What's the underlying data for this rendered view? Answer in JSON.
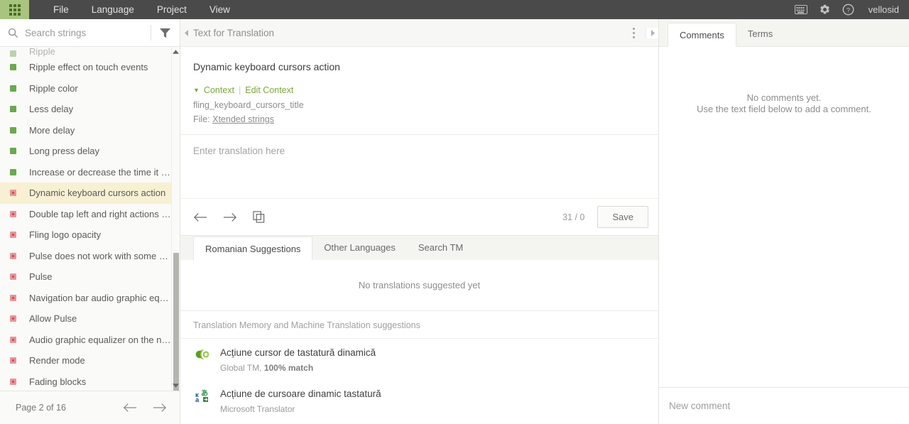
{
  "topbar": {
    "launcher_icon": "app-grid-icon",
    "menu": [
      {
        "label": "File"
      },
      {
        "label": "Language"
      },
      {
        "label": "Project"
      },
      {
        "label": "View"
      }
    ],
    "icons": [
      {
        "name": "keyboard-icon"
      },
      {
        "name": "gear-icon"
      },
      {
        "name": "help-icon"
      }
    ],
    "username": "vellosid"
  },
  "sidebar": {
    "search": {
      "value": "",
      "placeholder": "Search strings",
      "icon": "search-icon"
    },
    "filter_icon": "filter-icon",
    "items": [
      {
        "label": "Ripple effect on touch events",
        "status": "translated"
      },
      {
        "label": "Ripple color",
        "status": "translated"
      },
      {
        "label": "Less delay",
        "status": "translated"
      },
      {
        "label": "More delay",
        "status": "translated"
      },
      {
        "label": "Long press delay",
        "status": "translated"
      },
      {
        "label": "Increase or decrease the time it take...",
        "status": "translated"
      },
      {
        "label": "Dynamic keyboard cursors action",
        "status": "untranslated",
        "selected": true
      },
      {
        "label": "Double tap left and right actions bec...",
        "status": "untranslated"
      },
      {
        "label": "Fling logo opacity",
        "status": "untranslated"
      },
      {
        "label": "Pulse does not work with some audi...",
        "status": "untranslated"
      },
      {
        "label": "Pulse",
        "status": "untranslated"
      },
      {
        "label": "Navigation bar audio graphic equali...",
        "status": "untranslated"
      },
      {
        "label": "Allow Pulse",
        "status": "untranslated"
      },
      {
        "label": "Audio graphic equalizer on the navig...",
        "status": "untranslated"
      },
      {
        "label": "Render mode",
        "status": "untranslated"
      },
      {
        "label": "Fading blocks",
        "status": "untranslated"
      }
    ],
    "pager": {
      "label": "Page 2 of 16",
      "prev_icon": "arrow-left-icon",
      "next_icon": "arrow-right-icon"
    }
  },
  "center": {
    "header": {
      "title": "Text for Translation",
      "menu_icon": "kebab-menu-icon",
      "collapse_left_icon": "chevron-left-icon",
      "collapse_right_icon": "chevron-right-icon"
    },
    "source_text": "Dynamic keyboard cursors action",
    "context": {
      "toggle_label": "Context",
      "separator": "|",
      "edit_label": "Edit Context",
      "key": "fling_keyboard_cursors_title",
      "file_prefix": "File:",
      "file_name": "Xtended strings"
    },
    "translation": {
      "value": "",
      "placeholder": "Enter translation here",
      "prev_icon": "arrow-left-icon",
      "next_icon": "arrow-right-icon",
      "copy_icon": "copy-source-icon",
      "counter": "31 / 0",
      "save_label": "Save"
    },
    "tabs": [
      {
        "label": "Romanian Suggestions",
        "active": true
      },
      {
        "label": "Other Languages",
        "active": false
      },
      {
        "label": "Search TM",
        "active": false
      }
    ],
    "suggestions_empty": "No translations suggested yet",
    "tm_header": "Translation Memory and Machine Translation suggestions",
    "tm_items": [
      {
        "text": "Acțiune cursor de tastatură dinamică",
        "source": "Global TM,",
        "match": "100% match",
        "icon": "global-tm-icon"
      },
      {
        "text": "Acțiune de cursoare dinamic tastatură",
        "source": "Microsoft Translator",
        "match": "",
        "icon": "microsoft-translator-icon"
      }
    ]
  },
  "right": {
    "tabs": [
      {
        "label": "Comments",
        "active": true
      },
      {
        "label": "Terms",
        "active": false
      }
    ],
    "empty_line1": "No comments yet.",
    "empty_line2": "Use the text field below to add a comment.",
    "comment_input": {
      "value": "",
      "placeholder": "New comment"
    }
  },
  "colors": {
    "brand_green": "#a8c47f",
    "link_green": "#7aa83e",
    "topbar": "#4a4a4a",
    "selected_row": "#f7f0d2",
    "status_translated": "#6aa84f",
    "status_untranslated": "#d44a52"
  }
}
